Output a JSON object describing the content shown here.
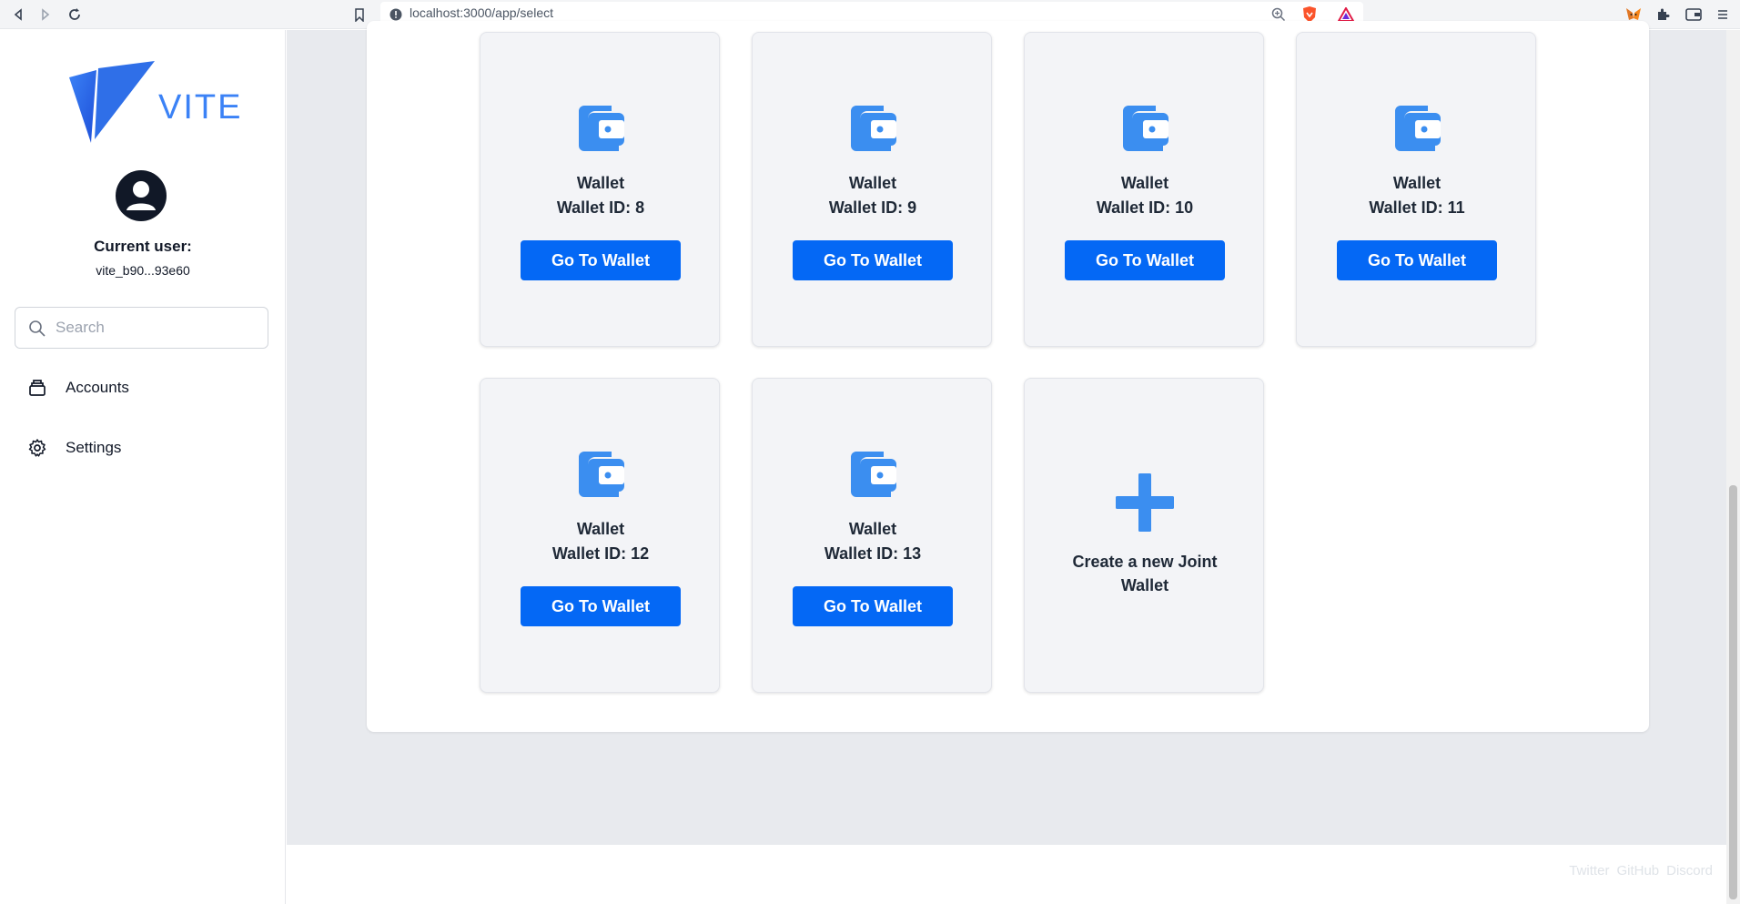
{
  "browser": {
    "url": "localhost:3000/app/select"
  },
  "sidebar": {
    "logo_text": "VITE",
    "current_user_label": "Current user:",
    "user_id": "vite_b90...93e60",
    "search_placeholder": "Search",
    "nav": [
      {
        "label": "Accounts",
        "icon": "archive-icon"
      },
      {
        "label": "Settings",
        "icon": "gear-icon"
      }
    ]
  },
  "wallets": [
    {
      "title": "Wallet",
      "id_label": "Wallet ID: 8",
      "button": "Go To Wallet"
    },
    {
      "title": "Wallet",
      "id_label": "Wallet ID: 9",
      "button": "Go To Wallet"
    },
    {
      "title": "Wallet",
      "id_label": "Wallet ID: 10",
      "button": "Go To Wallet"
    },
    {
      "title": "Wallet",
      "id_label": "Wallet ID: 11",
      "button": "Go To Wallet"
    },
    {
      "title": "Wallet",
      "id_label": "Wallet ID: 12",
      "button": "Go To Wallet"
    },
    {
      "title": "Wallet",
      "id_label": "Wallet ID: 13",
      "button": "Go To Wallet"
    }
  ],
  "create_card": {
    "label": "Create a new Joint Wallet"
  },
  "footer": {
    "links": [
      "Twitter",
      "GitHub",
      "Discord"
    ]
  },
  "colors": {
    "accent": "#0468f5",
    "wallet_icon": "#3b8ef0",
    "logo": "#3b82f6"
  }
}
